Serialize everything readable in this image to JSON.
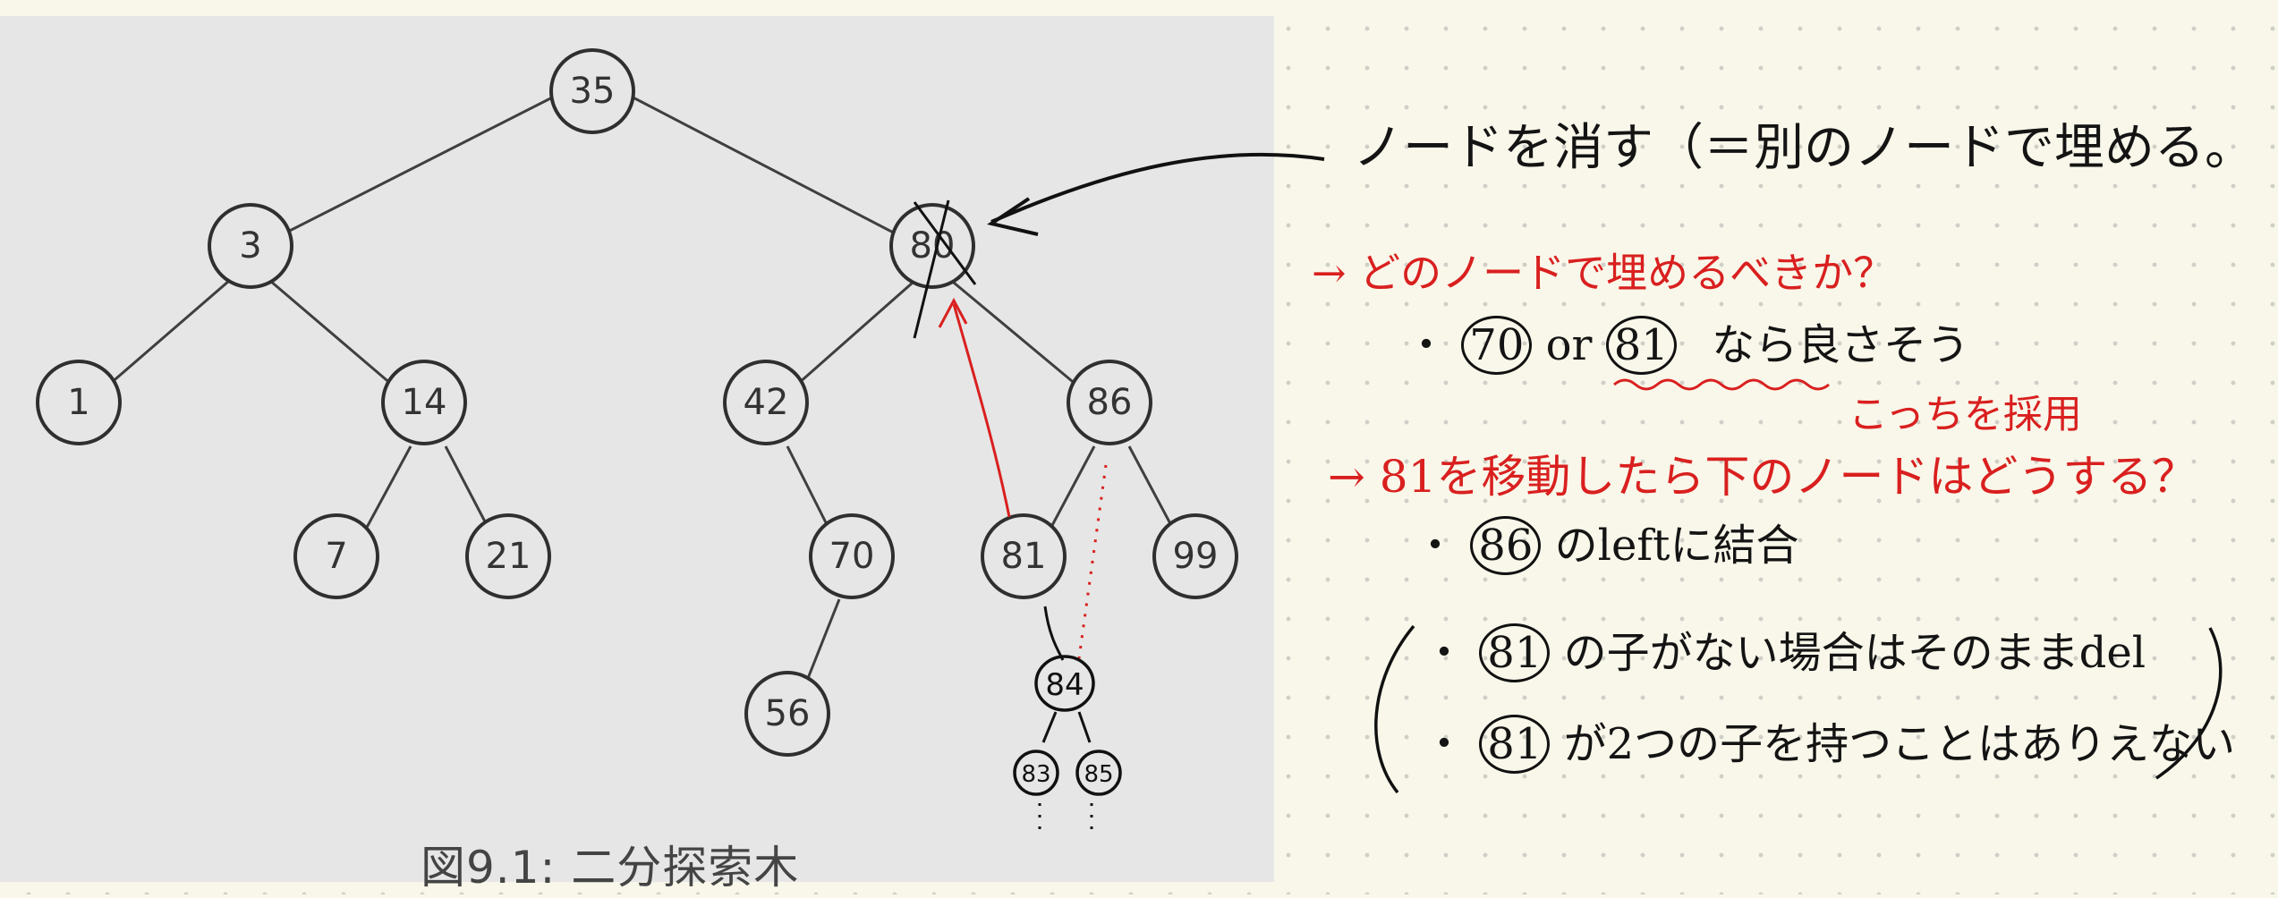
{
  "figure": {
    "caption": "図9.1: 二分探索木",
    "nodes": {
      "n35": "35",
      "n3": "3",
      "n80": "80",
      "n1": "1",
      "n14": "14",
      "n42": "42",
      "n86": "86",
      "n7": "7",
      "n21": "21",
      "n70": "70",
      "n81": "81",
      "n99": "99",
      "n56": "56"
    },
    "hand_nodes": {
      "h84": "84",
      "h83": "83",
      "h85": "85"
    }
  },
  "notes": {
    "line1": "ノードを消す（＝別のノードで埋める。",
    "line2": "→ どのノードで埋めるべきか？",
    "line3a": "・",
    "line3_n70": "70",
    "line3_or": "or",
    "line3_n81": "81",
    "line3b": "なら良さそう",
    "line4": "こっちを採用",
    "line5": "→ 81を移動したら下のノードはどうする？",
    "line6_n86": "86",
    "line6": "のleftに結合",
    "line7_n81": "81",
    "line7": "の子がない場合はそのままdel",
    "line8_n81": "81",
    "line8": "が2つの子を持つことはありえない"
  },
  "colors": {
    "ink_red": "#d9201f",
    "ink_black": "#141414",
    "figure_bg": "#e6e6e6",
    "paper": "#f9f7ea"
  }
}
